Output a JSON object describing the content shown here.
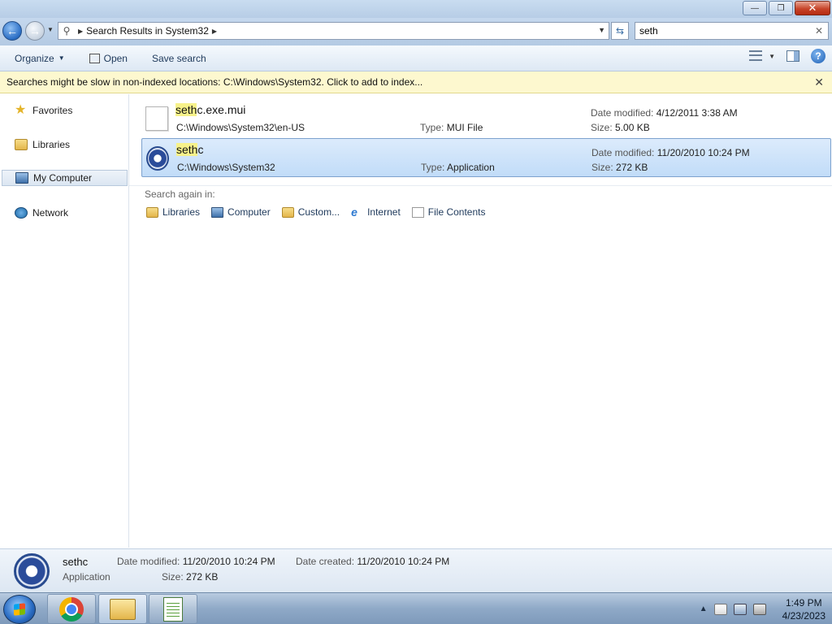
{
  "window": {
    "minimize_glyph": "—",
    "restore_glyph": "❐",
    "close_glyph": "✕"
  },
  "address": {
    "path_label": "Search Results in System32",
    "search_value": "seth"
  },
  "toolbar": {
    "organize_label": "Organize",
    "open_label": "Open",
    "save_search_label": "Save search"
  },
  "infobar": {
    "message": "Searches might be slow in non-indexed locations: C:\\Windows\\System32. Click to add to index..."
  },
  "sidebar": {
    "items": [
      {
        "label": "Favorites",
        "icon": "star-icon"
      },
      {
        "label": "Libraries",
        "icon": "libraries-icon"
      },
      {
        "label": "My Computer",
        "icon": "computer-icon",
        "selected": true
      },
      {
        "label": "Network",
        "icon": "network-icon"
      }
    ]
  },
  "results": [
    {
      "name_highlight": "seth",
      "name_rest": "c.exe.mui",
      "path": "C:\\Windows\\System32\\en-US",
      "type_label": "Type:",
      "type": "MUI File",
      "date_label": "Date modified:",
      "date": "4/12/2011 3:38 AM",
      "size_label": "Size:",
      "size": "5.00 KB"
    },
    {
      "name_highlight": "seth",
      "name_rest": "c",
      "path": "C:\\Windows\\System32",
      "type_label": "Type:",
      "type": "Application",
      "date_label": "Date modified:",
      "date": "11/20/2010 10:24 PM",
      "size_label": "Size:",
      "size": "272 KB",
      "selected": true
    }
  ],
  "search_again": {
    "label": "Search again in:",
    "options": [
      "Libraries",
      "Computer",
      "Custom...",
      "Internet",
      "File Contents"
    ]
  },
  "details": {
    "name": "sethc",
    "type": "Application",
    "date_modified_label": "Date modified:",
    "date_modified": "11/20/2010 10:24 PM",
    "date_created_label": "Date created:",
    "date_created": "11/20/2010 10:24 PM",
    "size_label": "Size:",
    "size": "272 KB"
  },
  "taskbar": {
    "time": "1:49 PM",
    "date": "4/23/2023"
  }
}
